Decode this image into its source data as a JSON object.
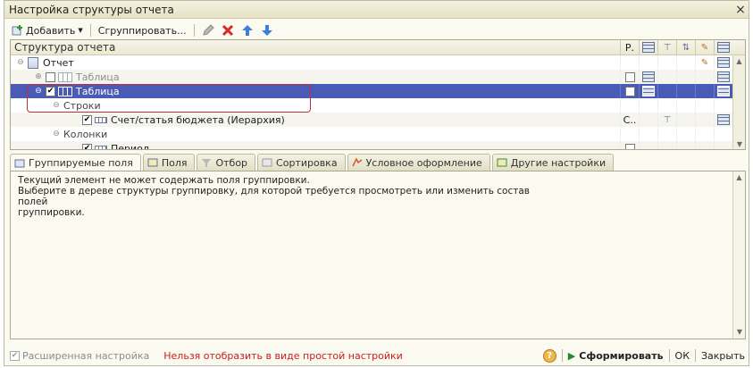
{
  "window": {
    "title": "Настройка структуры отчета",
    "close": "×"
  },
  "toolbar": {
    "add_label": "Добавить",
    "group_label": "Сгруппировать..."
  },
  "tree": {
    "header": "Структура отчета",
    "col_p": "Р.",
    "rows": [
      {
        "label": "Отчет",
        "level": 0,
        "icon": "document-icon"
      },
      {
        "label": "Таблица",
        "level": 1,
        "icon": "table-icon",
        "checked": false,
        "dim": true
      },
      {
        "label": "Таблица",
        "level": 1,
        "icon": "table-icon",
        "checked": true,
        "selected": true
      },
      {
        "label": "Строки",
        "level": 2,
        "icon": "none"
      },
      {
        "label": "Счет/статья бюджета (Иерархия)",
        "level": 3,
        "icon": "row-icon",
        "checked": true,
        "col_p": "С.."
      },
      {
        "label": "Колонки",
        "level": 2,
        "icon": "none"
      },
      {
        "label": "Период",
        "level": 3,
        "icon": "row-icon",
        "checked": true
      }
    ]
  },
  "tabs": [
    {
      "label": "Группируемые поля",
      "active": true
    },
    {
      "label": "Поля"
    },
    {
      "label": "Отбор"
    },
    {
      "label": "Сортировка"
    },
    {
      "label": "Условное оформление"
    },
    {
      "label": "Другие настройки"
    }
  ],
  "panel": {
    "line1": "Текущий элемент не может содержать поля группировки.",
    "line2": "Выберите в дереве структуры группировку, для которой требуется просмотреть или изменить состав полей",
    "line3": "группировки."
  },
  "footer": {
    "advanced_label": "Расширенная настройка",
    "warning": "Нельзя отобразить в виде простой настройки",
    "help": "?",
    "run_label": "Сформировать",
    "ok_label": "ОК",
    "close_label": "Закрыть"
  },
  "colors": {
    "selection": "#4a5bb6",
    "warning": "#c81e1e",
    "run_green": "#1f8a2c"
  }
}
